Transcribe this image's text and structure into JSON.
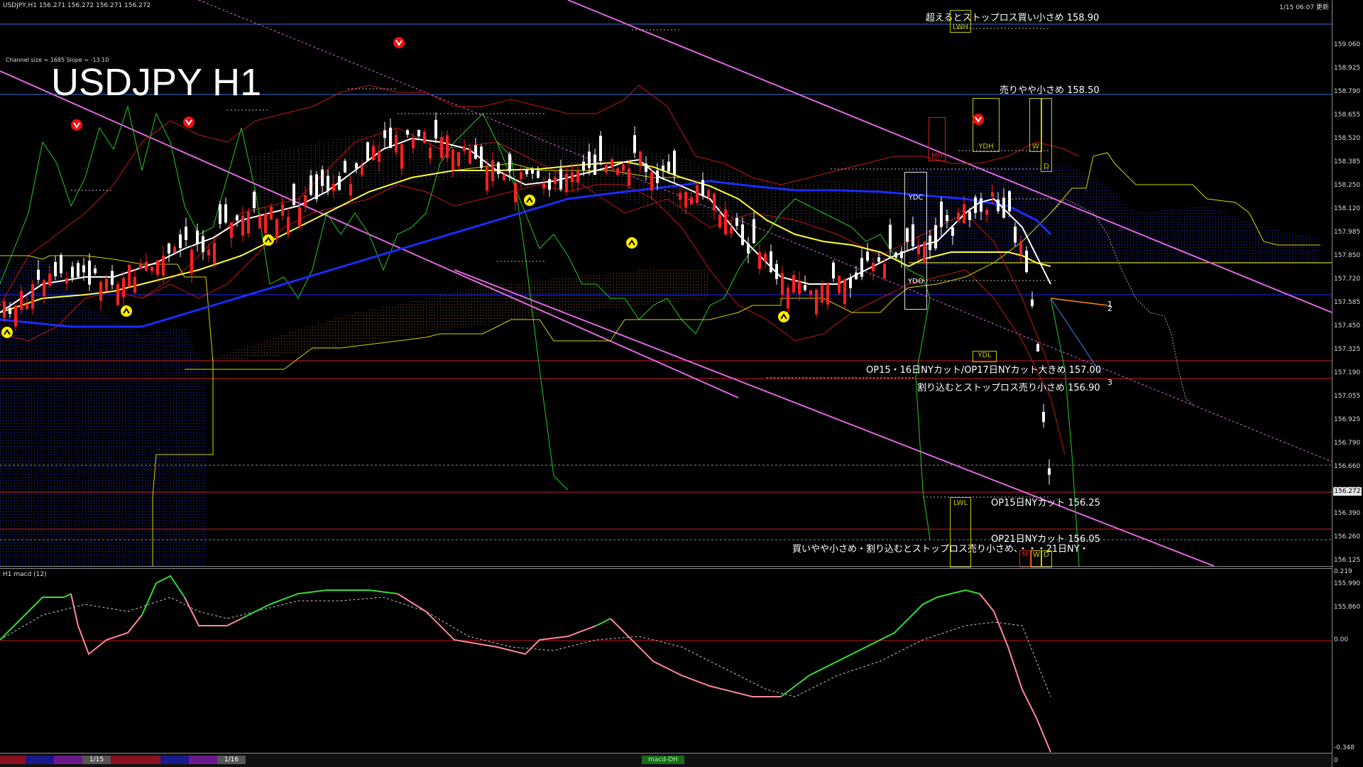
{
  "header": {
    "symbol_info": "USDJPY,H1  156.271 156.272 156.271 156.272",
    "datetime": "1/15 06:07 更新",
    "chart_title": "USDJPY H1",
    "channel_info": "Channel size = 1685 Slope = -13.10"
  },
  "levels": [
    {
      "label": "超えるとストップロス買い小さめ 158.90",
      "price": 158.9,
      "color": "#3b6fd6"
    },
    {
      "label": "売りやや小さめ 158.50",
      "price": 158.5,
      "color": "#3b6fd6"
    },
    {
      "label": "OP15・16日NYカット/OP17日NYカット大きめ 157.00",
      "price": 157.0,
      "color": "#d02020"
    },
    {
      "label": "割り込むとストップロス売り小さめ 156.90",
      "price": 156.9,
      "color": "#d02020"
    },
    {
      "label": "OP15日NYカット 156.25",
      "price": 156.25,
      "color": "#d02020"
    },
    {
      "label": "OP21日NYカット 156.05",
      "price": 156.05,
      "color": "#d02020"
    },
    {
      "label": "買いやや小さめ・割り込むとストップロス売り小さめ、・・・21日NY・",
      "price": 155.99,
      "color": "#bbbbbb"
    }
  ],
  "tags": {
    "lwh": "LWH",
    "ydh": "YDH",
    "ydc": "YDC",
    "ydo": "YDO",
    "ydl": "YDL",
    "lwl": "LWL",
    "w": "W",
    "d": "D",
    "m": "M",
    "mh": "MH"
  },
  "channel_marks": {
    "one": "1",
    "two": "2",
    "three": "3"
  },
  "price_axis": {
    "ticks": [
      "159.060",
      "158.925",
      "158.790",
      "158.655",
      "158.520",
      "158.385",
      "158.250",
      "158.120",
      "157.985",
      "157.850",
      "157.720",
      "157.585",
      "157.450",
      "157.325",
      "157.190",
      "157.055",
      "156.925",
      "156.790",
      "156.660",
      "156.525",
      "156.390",
      "156.260",
      "156.125",
      "155.990",
      "155.860"
    ],
    "current_price": "156.272"
  },
  "macd": {
    "label": "H1  macd (12)",
    "ticks": [
      "0.219",
      "0.00",
      "-0.348",
      "0"
    ]
  },
  "bottom": {
    "dates": [
      "1/15",
      "1/16"
    ],
    "tab_label": "macd-DH"
  },
  "colors": {
    "background": "#000000",
    "bull_candle": "#ffffff",
    "bear_candle": "#ff2020",
    "ma_fast": "#ffffff",
    "ma_mid": "#ffff00",
    "ma_slow": "#1a2cff",
    "channel": "#e066e0",
    "macd_up": "#33dd33",
    "macd_down": "#ff8899"
  },
  "icons": [
    "down-arrow-icon",
    "up-arrow-icon"
  ]
}
